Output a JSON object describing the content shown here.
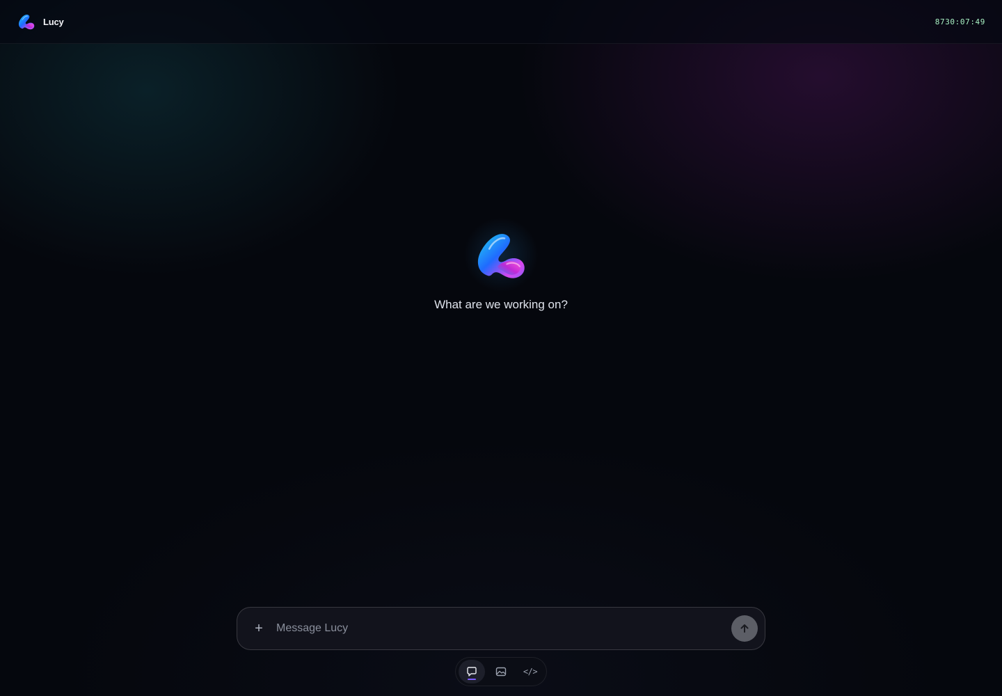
{
  "app": {
    "name": "Lucy",
    "timer": "8730:07:49"
  },
  "hero": {
    "prompt": "What are we working on?"
  },
  "composer": {
    "add_label": "+",
    "placeholder": "Message Lucy",
    "value": ""
  },
  "modes": {
    "active": "chat",
    "items": [
      {
        "id": "chat",
        "icon": "chat-bubble-icon"
      },
      {
        "id": "image",
        "icon": "image-icon"
      },
      {
        "id": "code",
        "icon": "code-icon",
        "label": "</>"
      }
    ]
  },
  "colors": {
    "background": "#05070d",
    "timer": "#a8f0c2",
    "send_button": "#5c5e66",
    "active_indicator": "#7c5cff",
    "logo_blue": "#1f6bff",
    "logo_cyan": "#22d3ee",
    "logo_magenta": "#d946ef"
  }
}
